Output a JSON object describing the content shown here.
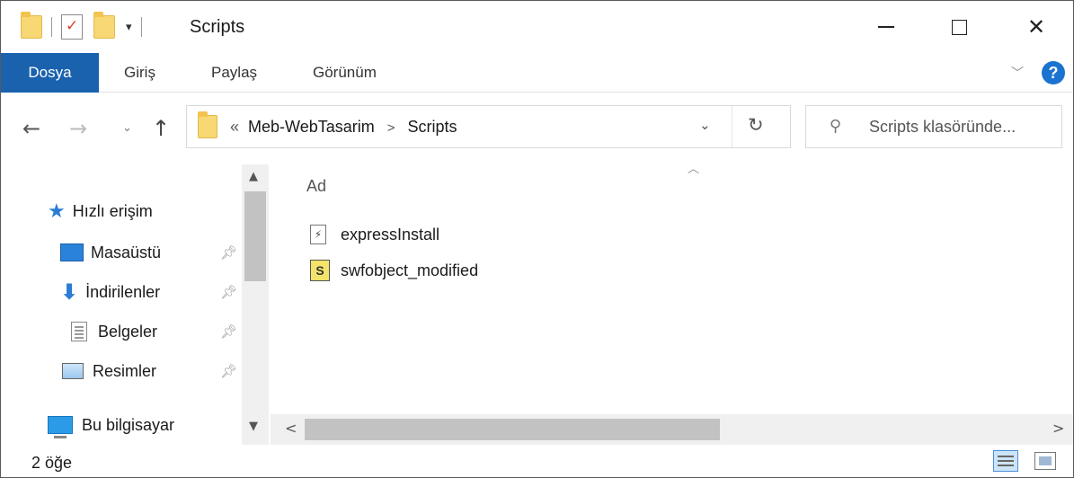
{
  "window": {
    "title": "Scripts",
    "qat_arrow": "▾",
    "minimize": "minimize",
    "maximize": "maximize",
    "close": "✕"
  },
  "ribbon": {
    "tabs": [
      "Dosya",
      "Giriş",
      "Paylaş",
      "Görünüm"
    ],
    "expand": "﹀",
    "help": "?"
  },
  "navbar": {
    "back": "←",
    "forward": "→",
    "recent": "⌄",
    "up": "↑",
    "address": {
      "overflow": "«",
      "crumbs": [
        "Meb-WebTasarim",
        "Scripts"
      ],
      "separator": ">",
      "dropdown": "⌄",
      "refresh": "↻"
    },
    "search": {
      "placeholder": "Scripts klasöründe..."
    }
  },
  "nav_pane": {
    "quick_access": "Hızlı erişim",
    "pinned": [
      {
        "label": "Masaüstü",
        "icon": "desktop-icon"
      },
      {
        "label": "İndirilenler",
        "icon": "downloads-icon"
      },
      {
        "label": "Belgeler",
        "icon": "documents-icon"
      },
      {
        "label": "Resimler",
        "icon": "pictures-icon"
      }
    ],
    "this_pc": "Bu bilgisayar"
  },
  "content": {
    "column_header": "Ad",
    "files": [
      {
        "name": "expressInstall",
        "icon": "swf-file-icon"
      },
      {
        "name": "swfobject_modified",
        "icon": "js-file-icon"
      }
    ]
  },
  "status": {
    "count": "2 öğe"
  },
  "colors": {
    "file_tab": "#1a62ae",
    "help": "#1a73d0",
    "accent": "#2b7cd3"
  }
}
